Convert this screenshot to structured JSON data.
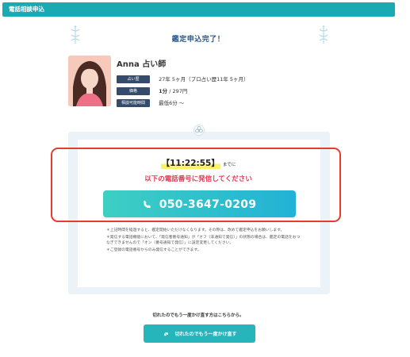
{
  "header": {
    "title": "電話相談申込"
  },
  "page_title": "鑑定申込完了！",
  "advisor": {
    "name": "Anna 占い師",
    "rows": [
      {
        "label": "占い歴",
        "value": "27年 5ヶ月（プロ占い歴11年 5ヶ月）",
        "value_bold": ""
      },
      {
        "label": "価格",
        "value_bold": "1分",
        "value": " / 297円"
      },
      {
        "label": "相談可能時間",
        "value": "最低6分 ～",
        "value_bold": ""
      }
    ]
  },
  "call": {
    "timer": "【11:22:55】",
    "timer_suffix": "までに",
    "instruction": "以下の電話番号に発信してください",
    "phone_number": "050-3647-0209"
  },
  "notes": [
    "＊上記時間を経過すると、鑑定開始いただけなくなります。その際は、改めて鑑定申込をお願いします。",
    "＊発信する電話機能において、「発信者番号通知」が「オフ（非通知で発信）」の状態の場合は、鑑定の電話をおつなぎできませんので「オン（番号通知で発信）」に設定変更してください。",
    "＊ご登録の電話番号からのみ発信することができます。"
  ],
  "retry": {
    "text": "切れたのでもう一度かけ直す方はこちらから。",
    "button_label": "切れたのでもう一度かけ直す"
  },
  "colors": {
    "header": "#1aaab4",
    "title": "#27598a",
    "instruction": "#e5384f",
    "highlight": "#e83a2f",
    "phone_button": "#22b2d5",
    "retry_button": "#25b5bb"
  }
}
